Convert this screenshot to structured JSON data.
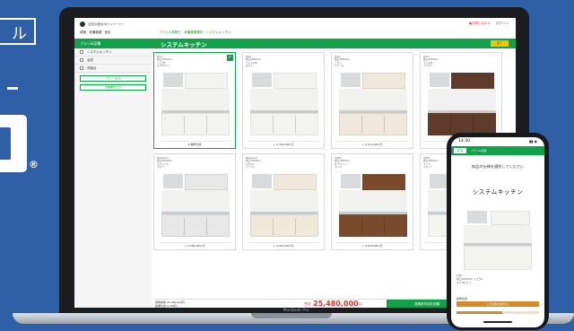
{
  "brand": {
    "fragment": "ル",
    "registered": "®"
  },
  "laptop": {
    "label": "MacBook Pro"
  },
  "app": {
    "logo_text": "住宅の総合ポイント·リー",
    "top_links": [
      "●お問い合わせ",
      "ログイン"
    ],
    "subbar_text": "新築 · 設備機器 · 設定",
    "breadcrumb": "プラン&見積り  ›  設備機器選択  ›  システムキッチン",
    "panel_title": "プラン&見積",
    "page_title": "システムキッチン",
    "header_button": "完了"
  },
  "sidebar": {
    "items": [
      "システムキッチン",
      "浴室",
      "洗面台"
    ],
    "buttons": [
      "プランへ戻る",
      "見積書を表示"
    ]
  },
  "cards": [
    {
      "meta": [
        "LIXIL",
        "間口2550mm",
        "シエラS",
        "オフホワイト"
      ],
      "price": "¥ 標準仕様",
      "style": "c-white",
      "selected": true
    },
    {
      "meta": [
        "LIXIL",
        "間口2550mm",
        "リシェルSI",
        "ホワイト"
      ],
      "price": "+ ¥ 345,000 円",
      "style": "c-white",
      "selected": false
    },
    {
      "meta": [
        "LIXIL",
        "間口2550mm",
        "ノクト",
        "クリーム"
      ],
      "price": "+ ¥ 215,000 円",
      "style": "c-cream",
      "selected": false
    },
    {
      "meta": [
        "LIXIL",
        "間口2550mm",
        "アレスタ",
        "ブラウン"
      ],
      "price": "+ ¥ 298,000 円",
      "style": "c-brown",
      "selected": false
    },
    {
      "meta": [
        "Panasonic",
        "間口2550mm",
        "ラクシーナ",
        "ホワイト"
      ],
      "price": "+ ¥ 185,000 円",
      "style": "c-grey",
      "selected": false
    },
    {
      "meta": [
        "Panasonic",
        "間口2550mm",
        "Lクラス",
        "ベージュ"
      ],
      "price": "+ ¥ 410,000 円",
      "style": "c-cream",
      "selected": false
    },
    {
      "meta": [
        "TOTO",
        "間口2550mm",
        "ザ·クラッソ",
        "ウッド"
      ],
      "price": "+ ¥ 520,000 円",
      "style": "c-wood",
      "selected": false
    },
    {
      "meta": [
        "TOTO",
        "間口2550mm",
        "ミッテ",
        "ホワイト"
      ],
      "price": "+ ¥ 156,000 円",
      "style": "c-white",
      "selected": false
    }
  ],
  "bottom": {
    "summary_line1": "建物本体   25,480,000円",
    "summary_line2": "設備仕様      0,000円",
    "total_label": "合計",
    "total": "25,480,000",
    "total_unit": "円",
    "submit_button": "見積書作成を依頼"
  },
  "phone": {
    "time": "14:30",
    "signal": "▮▮ ◉",
    "back": "戻る",
    "nav_text": "プラン&見積",
    "heading": "商品の仕様を選択してください",
    "title": "システムキッチン",
    "meta": [
      "LIXIL",
      "間口2550mm シエラS",
      "オフホワイト"
    ],
    "label": "標準仕様",
    "button": "この仕様を選択する",
    "progress": 0.55
  },
  "colors": {
    "accent": "#12a04a",
    "background": "#2f5fa6",
    "total": "#dd3333",
    "phone_button": "#d88a2b"
  }
}
